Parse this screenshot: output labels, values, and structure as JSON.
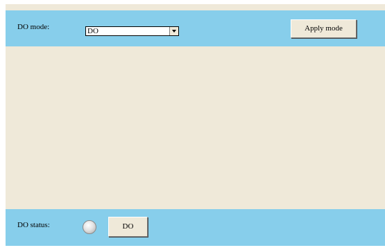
{
  "mode_panel": {
    "label": "DO mode:",
    "select_value": "DO",
    "apply_button_label": "Apply mode"
  },
  "status_panel": {
    "label": "DO status:",
    "indicator_state": "off",
    "do_button_label": "DO"
  },
  "colors": {
    "panel_band": "#87ceeb",
    "background": "#efe9d9"
  }
}
